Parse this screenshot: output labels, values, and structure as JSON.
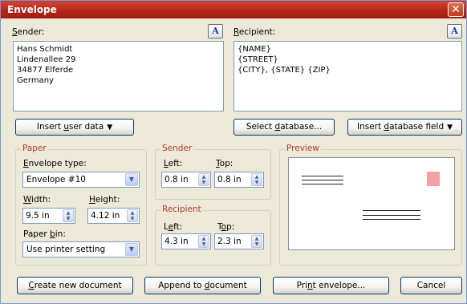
{
  "window": {
    "title": "Envelope",
    "close_glyph": "✕"
  },
  "sender": {
    "label": "Sender:",
    "label_underline": "S",
    "label_rest": "ender:",
    "lines": "Hans Schmidt\nLindenallee 29\n34877 Elferde\nGermany"
  },
  "recipient": {
    "label_underline": "R",
    "label_rest": "ecipient:",
    "lines": "{NAME}\n{STREET}\n{CITY}, {STATE} {ZIP}"
  },
  "font_button": {
    "glyph": "A"
  },
  "buttons": {
    "insert_user_data": {
      "pre": "Insert ",
      "u": "u",
      "post": "ser data"
    },
    "select_database": {
      "pre": "Select ",
      "u": "d",
      "post": "atabase..."
    },
    "insert_database_field": {
      "pre": "Insert ",
      "u": "d",
      "post": "atabase field"
    },
    "create_new_document": {
      "pre": "",
      "u": "C",
      "post": "reate new document"
    },
    "append_to_document": {
      "pre": "Append to ",
      "u": "d",
      "post": "ocument"
    },
    "print_envelope": {
      "pre": "Pri",
      "u": "n",
      "post": "t envelope..."
    },
    "cancel": {
      "label": "Cancel"
    },
    "dropdown_arrow": "▼"
  },
  "paper": {
    "group_title": "Paper",
    "envelope_type_label": {
      "pre": "",
      "u": "E",
      "post": "nvelope type:"
    },
    "envelope_type_value": "Envelope #10",
    "width_label": {
      "pre": "",
      "u": "W",
      "post": "idth:"
    },
    "width_value": "9.5 in",
    "height_label": {
      "pre": "",
      "u": "H",
      "post": "eight:"
    },
    "height_value": "4.12 in",
    "paper_bin_label": {
      "pre": "Paper ",
      "u": "b",
      "post": "in:"
    },
    "paper_bin_value": "Use printer setting"
  },
  "sender_pos": {
    "group_title": "Sender",
    "left_label": {
      "pre": "",
      "u": "L",
      "post": "eft:"
    },
    "left_value": "0.8 in",
    "top_label": {
      "pre": "",
      "u": "T",
      "post": "op:"
    },
    "top_value": "0.8 in"
  },
  "recipient_pos": {
    "group_title": "Recipient",
    "left_label": {
      "pre": "L",
      "u": "e",
      "post": "ft:"
    },
    "left_value": "4.3 in",
    "top_label": {
      "pre": "T",
      "u": "o",
      "post": "p:"
    },
    "top_value": "2.3 in"
  },
  "preview": {
    "group_title": "Preview",
    "stamp_color": "#f4a1a5"
  },
  "colors": {
    "title_bar": "#b5251a",
    "group_title": "#b03a2e",
    "dialog_bg": "#ece9d8"
  },
  "spin_glyphs": {
    "up": "▲",
    "down": "▼"
  },
  "select_glyph": "▼"
}
